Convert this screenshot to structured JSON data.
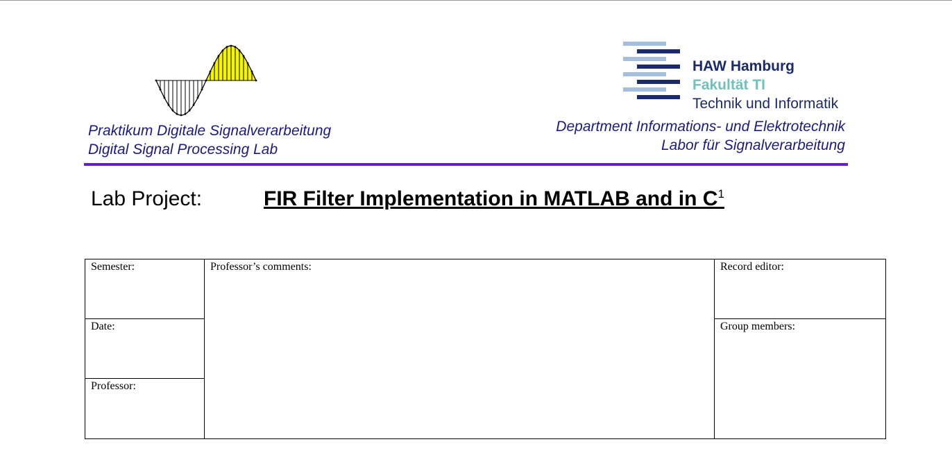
{
  "header": {
    "lab_lines": [
      "Praktikum Digitale Signalverarbeitung",
      "Digital Signal Processing Lab"
    ],
    "university": {
      "name": "HAW Hamburg",
      "faculty": "Fakultät TI",
      "subtitle": "Technik und Informatik"
    },
    "department_lines": [
      "Department Informations- und Elektrotechnik",
      "Labor für Signalverarbeitung"
    ]
  },
  "project": {
    "label": "Lab Project:",
    "title": "FIR Filter Implementation in MATLAB and in C",
    "footnote_mark": "1"
  },
  "form": {
    "semester": "Semester:",
    "date": "Date:",
    "professor": "Professor:",
    "professor_comments": "Professor’s comments:",
    "record_editor": "Record editor:",
    "group_members": "Group members:"
  },
  "colors": {
    "text_navy": "#1a1a80",
    "haw_navy": "#1a2a6c",
    "haw_teal": "#6dc2bd",
    "haw_light_blue": "#a3bfdc",
    "rule_purple": "#6a1fc4",
    "wave_fill": "#f5f500"
  },
  "icons": [
    "sine-wave-logo-icon",
    "haw-logo-bars-icon"
  ]
}
